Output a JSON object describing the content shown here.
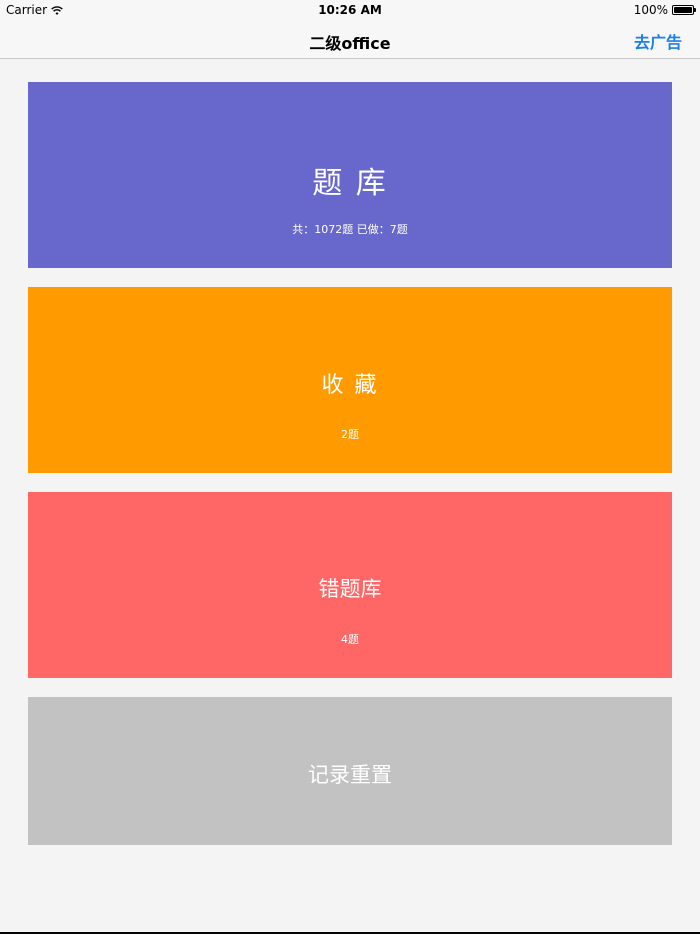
{
  "status_bar": {
    "carrier": "Carrier",
    "time": "10:26 AM",
    "battery": "100%"
  },
  "nav": {
    "title": "二级office",
    "action": "去广告"
  },
  "cards": {
    "tiku": {
      "title": "题 库",
      "subtitle": "共：1072题  已做：7题",
      "color": "#6767cc"
    },
    "shoucang": {
      "title": "收 藏",
      "subtitle": "2题",
      "color": "#ff9a00"
    },
    "cuoti": {
      "title": "错题库",
      "subtitle": "4题",
      "color": "#ff6767"
    },
    "reset": {
      "title": "记录重置",
      "color": "#c2c2c2"
    }
  },
  "colors": {
    "background": "#f4f4f4",
    "accent": "#1a7fe8"
  }
}
